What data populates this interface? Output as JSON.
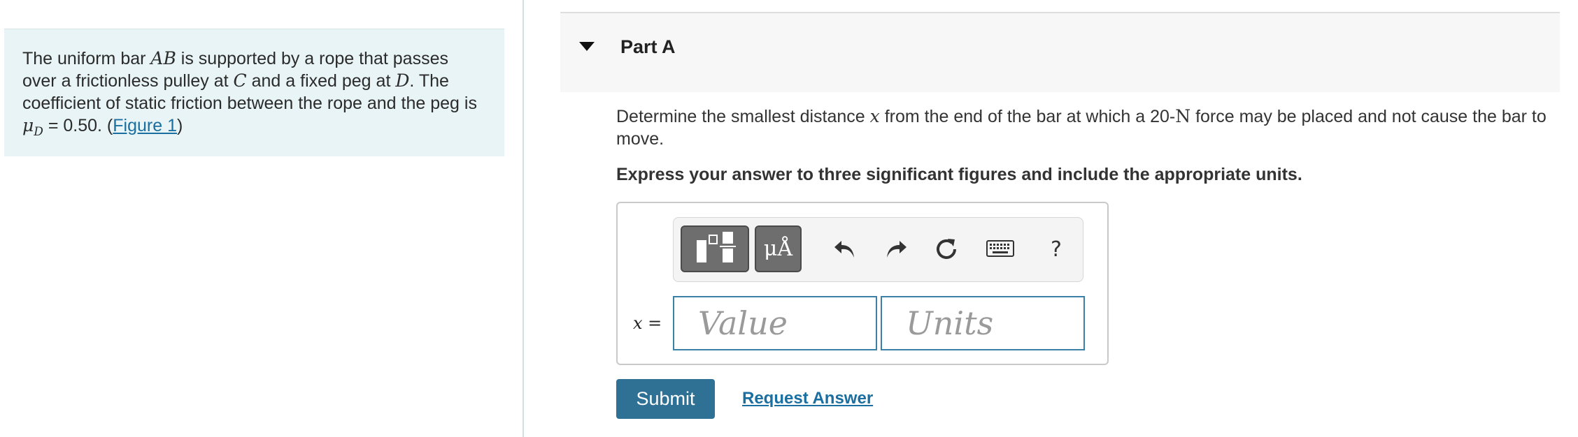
{
  "problem": {
    "t1": "The uniform bar ",
    "bar": "AB",
    "t2": " is supported by a rope that passes over a frictionless pulley at ",
    "c": "C",
    "t3": " and a fixed peg at ",
    "d": "D",
    "t4": ". The coefficient of static friction between the rope and the peg is ",
    "mu": "μ",
    "mu_sub": "D",
    "t5": " = 0.50. (",
    "figure_link": "Figure 1",
    "t6": ")"
  },
  "part": {
    "title": "Part A"
  },
  "question": {
    "q1": "Determine the smallest distance ",
    "var": "x",
    "q2": " from the end of the bar at which a 20-",
    "unit": "N",
    "q3": " force may be placed and not cause the bar to move."
  },
  "instruction": "Express your answer to three significant figures and include the appropriate units.",
  "toolbar": {
    "units_label": "μÅ",
    "help_label": "?",
    "icons": [
      "templates-icon",
      "units-icon",
      "undo-icon",
      "redo-icon",
      "reset-icon",
      "keyboard-icon",
      "help-icon"
    ]
  },
  "answer": {
    "var_label": "x =",
    "value_placeholder": "Value",
    "units_placeholder": "Units"
  },
  "buttons": {
    "submit": "Submit",
    "request": "Request Answer"
  },
  "colors": {
    "panel_bg": "#e8f4f5",
    "accent": "#2e7195",
    "link": "#1a6fa0"
  }
}
